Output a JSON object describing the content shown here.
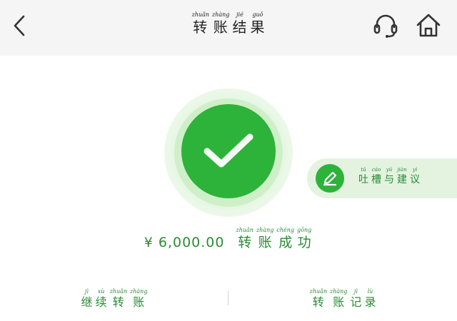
{
  "header": {
    "title": [
      {
        "pinyin": "zhuǎn",
        "hanzi": "转"
      },
      {
        "pinyin": "zhàng",
        "hanzi": "账"
      },
      {
        "pinyin": "jié",
        "hanzi": "结"
      },
      {
        "pinyin": "guǒ",
        "hanzi": "果"
      }
    ],
    "back_icon": "chevron-left-icon",
    "support_icon": "headset-icon",
    "home_icon": "home-icon"
  },
  "result": {
    "status_icon": "check-circle-icon",
    "amount": "¥ 6,000.00",
    "status_text": [
      {
        "pinyin": "zhuǎn",
        "hanzi": "转"
      },
      {
        "pinyin": "zhàng",
        "hanzi": "账"
      },
      {
        "pinyin": "chéng",
        "hanzi": "成"
      },
      {
        "pinyin": "gōng",
        "hanzi": "功"
      }
    ]
  },
  "feedback": {
    "icon": "pencil-icon",
    "label": [
      {
        "pinyin": "tǔ",
        "hanzi": "吐"
      },
      {
        "pinyin": "cáo",
        "hanzi": "槽"
      },
      {
        "pinyin": "yǔ",
        "hanzi": "与"
      },
      {
        "pinyin": "jiàn",
        "hanzi": "建"
      },
      {
        "pinyin": "yì",
        "hanzi": "议"
      }
    ]
  },
  "actions": {
    "continue": [
      {
        "pinyin": "jì",
        "hanzi": "继"
      },
      {
        "pinyin": "xù",
        "hanzi": "续"
      },
      {
        "pinyin": "zhuǎn",
        "hanzi": "转"
      },
      {
        "pinyin": "zhàng",
        "hanzi": "账"
      }
    ],
    "records": [
      {
        "pinyin": "zhuǎn",
        "hanzi": "转"
      },
      {
        "pinyin": "zhàng",
        "hanzi": "账"
      },
      {
        "pinyin": "jì",
        "hanzi": "记"
      },
      {
        "pinyin": "lù",
        "hanzi": "录"
      }
    ]
  },
  "colors": {
    "accent": "#2db33a",
    "accent_text": "#2a8c34",
    "header_bg": "#f5f5f5",
    "feedback_bg": "#e3f3df"
  }
}
